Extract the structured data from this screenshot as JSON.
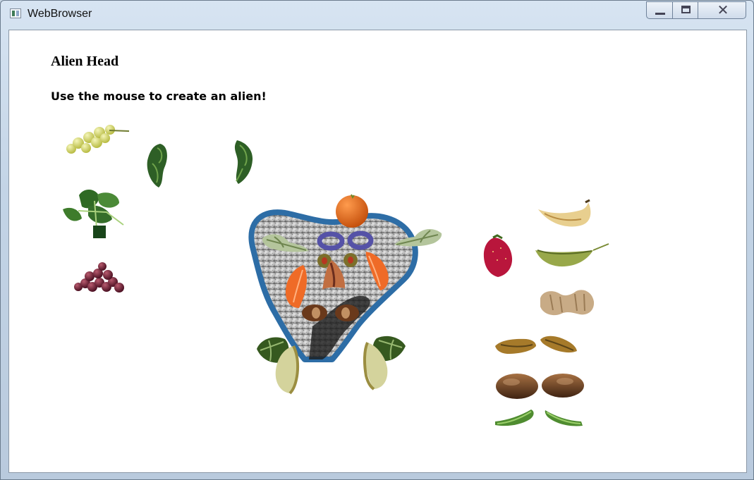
{
  "window": {
    "title": "WebBrowser",
    "icon": "app-window-icon",
    "controls": [
      "minimize-button",
      "maximize-button",
      "close-button"
    ]
  },
  "page": {
    "heading": "Alien Head",
    "instruction": "Use the mouse to create an alien!"
  },
  "palette": {
    "left_column": [
      "grapes-green",
      "spinach",
      "grapes-red"
    ],
    "top_row": [
      "broccoli-piece-left",
      "broccoli-piece-right"
    ],
    "right_column": [
      "banana",
      "strawberry",
      "pea-pod",
      "peanut",
      "pickle-left",
      "pickle-right",
      "kiwi-left",
      "kiwi-right",
      "green-bean-left",
      "green-bean-right"
    ]
  },
  "alien_head": {
    "base": "potato-head",
    "parts": [
      "orange-top",
      "lettuce-brow-left",
      "lettuce-brow-right",
      "onion-ring-left",
      "onion-ring-right",
      "olive-left",
      "olive-right",
      "carrot-nose",
      "orange-slice-left",
      "orange-slice-right",
      "nut-left",
      "nut-right",
      "lettuce-chin-left",
      "lettuce-chin-right",
      "apple-slice-left",
      "apple-slice-right"
    ]
  }
}
